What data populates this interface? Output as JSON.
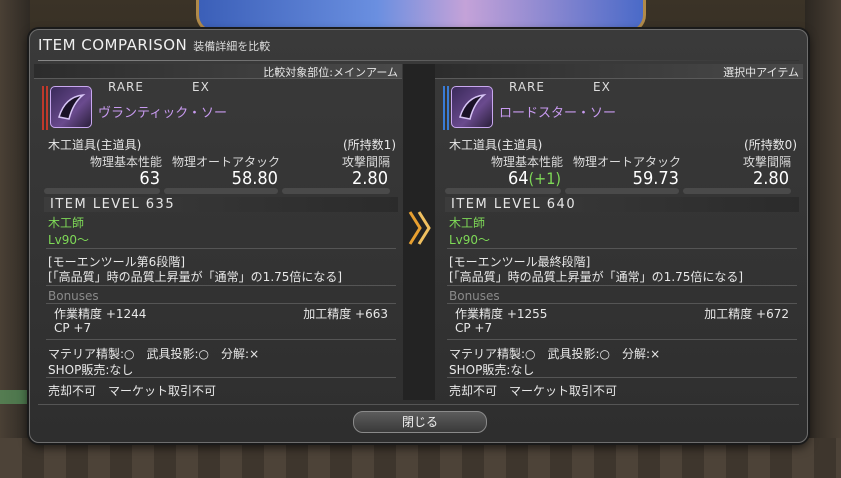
{
  "window": {
    "title": "ITEM COMPARISON",
    "subtitle": "装備詳細を比較",
    "close_label": "閉じる"
  },
  "left": {
    "header": "比較対象部位:メインアーム",
    "rarity": "RARE",
    "ex": "EX",
    "name": "ヴランティック・ソー",
    "category": "木工道具(主道具)",
    "owned": "(所持数1)",
    "stats": [
      {
        "label": "物理基本性能",
        "value": "63",
        "diff": ""
      },
      {
        "label": "物理オートアタック",
        "value": "58.80",
        "diff": ""
      },
      {
        "label": "攻撃間隔",
        "value": "2.80",
        "diff": ""
      }
    ],
    "item_level": "ITEM LEVEL 635",
    "job": "木工師",
    "level": "Lv90～",
    "desc1": "[モーエンツール第6段階]",
    "desc2": "[「高品質」時の品質上昇量が「通常」の1.75倍になる]",
    "bonuses_label": "Bonuses",
    "bonus1": "作業精度 +1244",
    "bonus2": "加工精度 +663",
    "bonus3": "CP +7",
    "materia": "マテリア精製:○　武具投影:○　分解:×",
    "shop": "SHOP販売:なし",
    "trade": "売却不可　マーケット取引不可"
  },
  "right": {
    "header": "選択中アイテム",
    "rarity": "RARE",
    "ex": "EX",
    "name": "ロードスター・ソー",
    "category": "木工道具(主道具)",
    "owned": "(所持数0)",
    "stats": [
      {
        "label": "物理基本性能",
        "value": "64",
        "diff": "(+1)"
      },
      {
        "label": "物理オートアタック",
        "value": "59.73",
        "diff": ""
      },
      {
        "label": "攻撃間隔",
        "value": "2.80",
        "diff": ""
      }
    ],
    "item_level": "ITEM LEVEL 640",
    "job": "木工師",
    "level": "Lv90～",
    "desc1": "[モーエンツール最終段階]",
    "desc2": "[「高品質」時の品質上昇量が「通常」の1.75倍になる]",
    "bonuses_label": "Bonuses",
    "bonus1": "作業精度 +1255",
    "bonus2": "加工精度 +672",
    "bonus3": "CP +7",
    "materia": "マテリア精製:○　武具投影:○　分解:×",
    "shop": "SHOP販売:なし",
    "trade": "売却不可　マーケット取引不可"
  },
  "icons": {
    "compare_arrow": "double-chevron-right-icon",
    "item": "saw-icon"
  },
  "colors": {
    "item_name": "#c89af0",
    "positive": "#7ed957",
    "arrow": "#e8a030"
  }
}
